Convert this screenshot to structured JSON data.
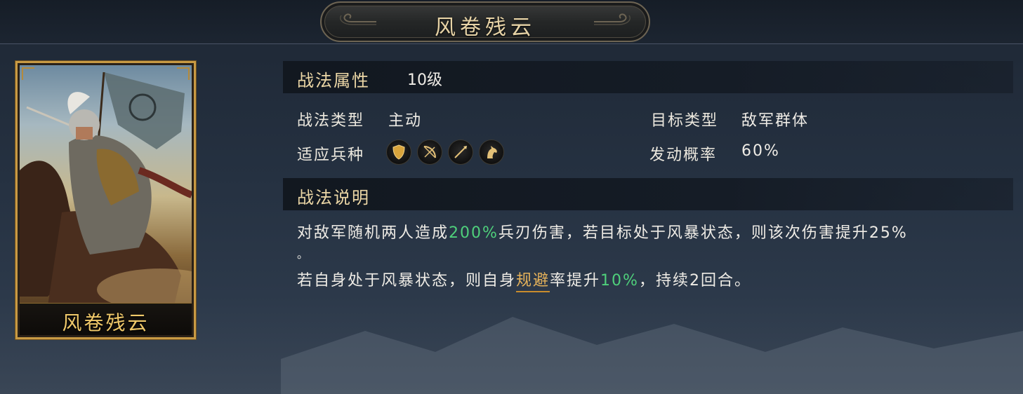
{
  "header": {
    "title": "风卷残云"
  },
  "card": {
    "name": "风卷残云"
  },
  "attributes": {
    "section_label": "战法属性",
    "level": "10级",
    "tactic_type_label": "战法类型",
    "tactic_type_value": "主动",
    "target_type_label": "目标类型",
    "target_type_value": "敌军群体",
    "troop_label": "适应兵种",
    "troop_icons": [
      "shield-icon",
      "bow-icon",
      "spear-icon",
      "horse-icon"
    ],
    "trigger_rate_label": "发动概率",
    "trigger_rate_value": "60%"
  },
  "description": {
    "section_label": "战法说明",
    "line1_a": "对敌军随机两人造成",
    "line1_b": "200%",
    "line1_c": "兵刃伤害，若目标处于风暴状态，则该次伤害提升25%",
    "line2": "。",
    "line3_a": "若自身处于风暴状态，则自身",
    "line3_b": "规避",
    "line3_c": "率提升",
    "line3_d": "10%",
    "line3_e": "，持续2回合。"
  },
  "colors": {
    "accent_gold": "#e6b25a",
    "highlight_green": "#4fd07b",
    "card_border": "#c89a44"
  }
}
